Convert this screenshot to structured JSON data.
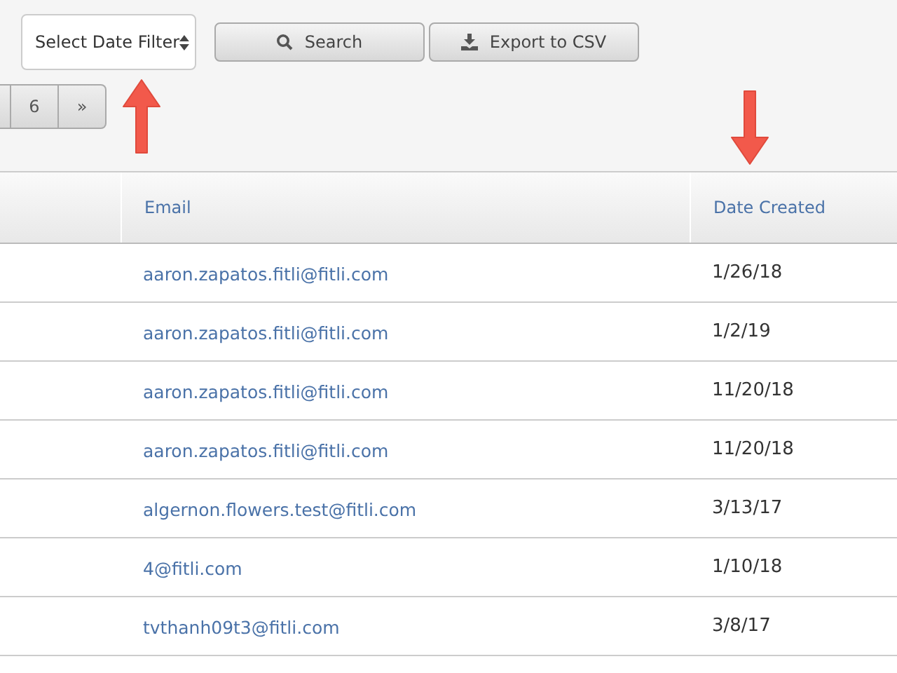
{
  "toolbar": {
    "date_filter": {
      "placeholder": "Select Date Filter"
    },
    "buttons": [
      {
        "kind": "search",
        "label": "Search"
      },
      {
        "kind": "export",
        "label": "Export to CSV"
      }
    ]
  },
  "pagination": [
    "6",
    "»"
  ],
  "table": {
    "columns": [
      "Email",
      "Date Created"
    ],
    "rows": [
      {
        "email": "aaron.zapatos.fitli@fitli.com",
        "date": "1/26/18"
      },
      {
        "email": "aaron.zapatos.fitli@fitli.com",
        "date": "1/2/19"
      },
      {
        "email": "aaron.zapatos.fitli@fitli.com",
        "date": "11/20/18"
      },
      {
        "email": "aaron.zapatos.fitli@fitli.com",
        "date": "11/20/18"
      },
      {
        "email": "algernon.flowers.test@fitli.com",
        "date": "3/13/17"
      },
      {
        "email": "4@fitli.com",
        "date": "1/10/18"
      },
      {
        "email": "tvthanh09t3@fitli.com",
        "date": "3/8/17"
      }
    ]
  }
}
